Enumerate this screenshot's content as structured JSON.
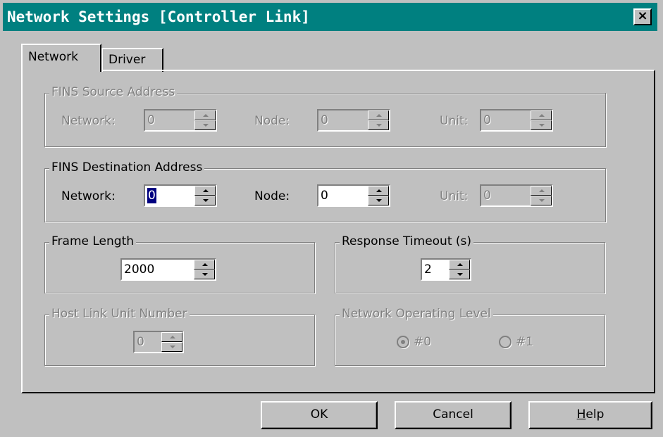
{
  "window": {
    "title": "Network Settings [Controller Link]",
    "close_symbol": "×"
  },
  "tabs": [
    {
      "label": "Network"
    },
    {
      "label": "Driver"
    }
  ],
  "fins_source": {
    "legend": "FINS Source Address",
    "network_label": "Network:",
    "network_value": "0",
    "node_label": "Node:",
    "node_value": "0",
    "unit_label": "Unit:",
    "unit_value": "0"
  },
  "fins_destination": {
    "legend": "FINS Destination Address",
    "network_label": "Network:",
    "network_value": "0",
    "node_label": "Node:",
    "node_value": "0",
    "unit_label": "Unit:",
    "unit_value": "0"
  },
  "frame_length": {
    "legend": "Frame Length",
    "value": "2000"
  },
  "response_timeout": {
    "legend": "Response Timeout (s)",
    "value": "2"
  },
  "host_link": {
    "legend": "Host Link Unit Number",
    "value": "0"
  },
  "operating_level": {
    "legend": "Network Operating Level",
    "options": [
      {
        "label": "#0",
        "selected": true
      },
      {
        "label": "#1",
        "selected": false
      }
    ]
  },
  "buttons": {
    "ok": "OK",
    "cancel": "Cancel",
    "help_mnemonic": "H",
    "help_rest": "elp"
  },
  "colors": {
    "titlebar": "#008080",
    "face": "#c0c0c0",
    "selection": "#000080"
  }
}
